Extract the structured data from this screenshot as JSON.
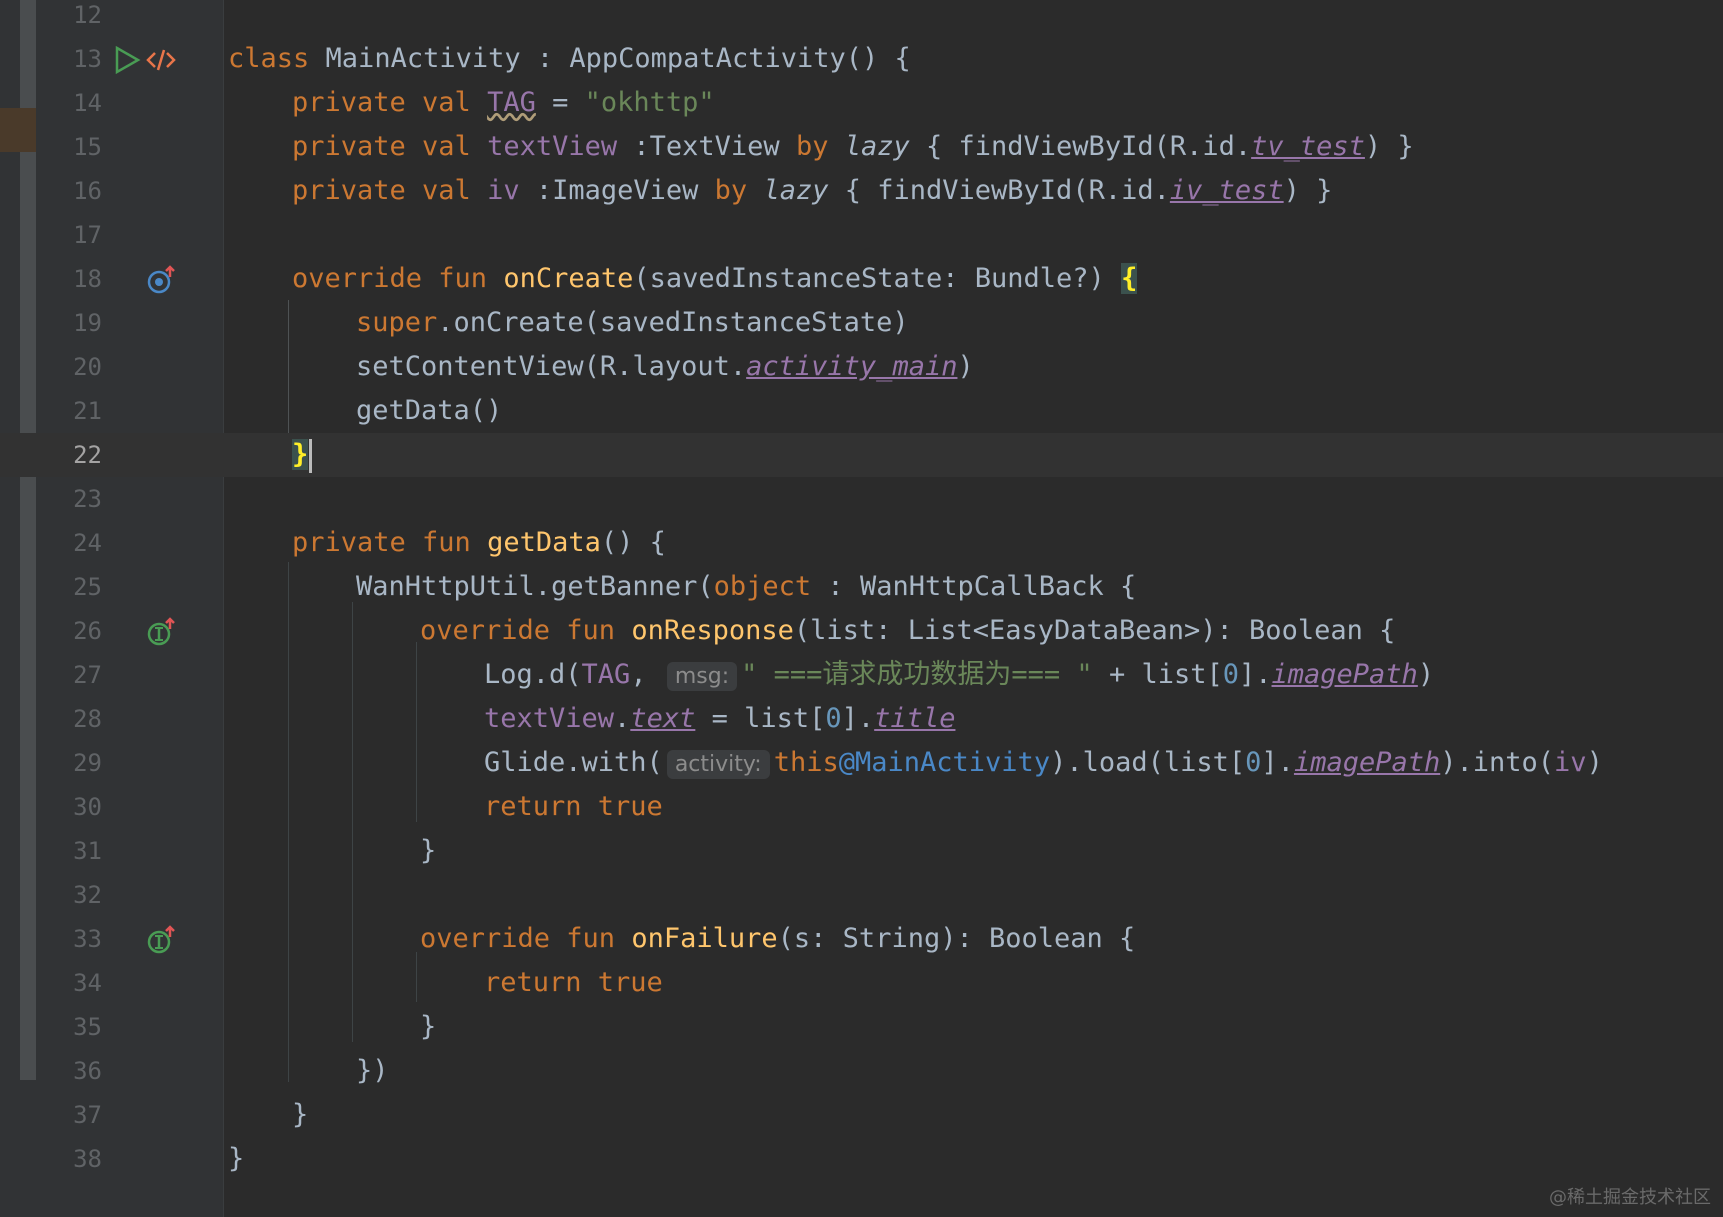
{
  "editor": {
    "language": "kotlin",
    "current_line": "22",
    "lines": [
      {
        "n": "12"
      },
      {
        "n": "13",
        "t1": "class",
        "t2": "MainActivity",
        "t3": " : AppCompatActivity() {"
      },
      {
        "n": "14",
        "t1": "private val",
        "t2": "TAG",
        "t3": " = ",
        "t4": "\"okhttp\""
      },
      {
        "n": "15",
        "t1": "private val",
        "t2": "textView",
        "t3": " :TextView ",
        "t4": "by",
        "t5": "lazy",
        "t6": " { findViewById(R.id.",
        "t7": "tv_test",
        "t8": ") }"
      },
      {
        "n": "16",
        "t1": "private val",
        "t2": "iv",
        "t3": " :ImageView ",
        "t4": "by",
        "t5": "lazy",
        "t6": " { findViewById(R.id.",
        "t7": "iv_test",
        "t8": ") }"
      },
      {
        "n": "17"
      },
      {
        "n": "18",
        "t1": "override fun",
        "t2": "onCreate",
        "t3": "(savedInstanceState: Bundle?) ",
        "t4": "{"
      },
      {
        "n": "19",
        "t1": "super",
        "t2": ".onCreate(savedInstanceState)"
      },
      {
        "n": "20",
        "t1": "setContentView(R.layout.",
        "t2": "activity_main",
        "t3": ")"
      },
      {
        "n": "21",
        "t1": "getData()"
      },
      {
        "n": "22",
        "t1": "}"
      },
      {
        "n": "23"
      },
      {
        "n": "24",
        "t1": "private fun",
        "t2": "getData",
        "t3": "() {"
      },
      {
        "n": "25",
        "t1": "WanHttpUtil.getBanner(",
        "t2": "object",
        "t3": " : WanHttpCallBack {"
      },
      {
        "n": "26",
        "t1": "override fun",
        "t2": "onResponse",
        "t3": "(list: List<EasyDataBean>): Boolean {"
      },
      {
        "n": "27",
        "t1": "Log.d(",
        "t2": "TAG",
        "t3": ", ",
        "hint": "msg:",
        "t4": "\" ===请求成功数据为=== \"",
        "t5": " + list[",
        "t6": "0",
        "t7": "].",
        "t8": "imagePath",
        "t9": ")"
      },
      {
        "n": "28",
        "t1": "textView",
        "t2": ".",
        "t3": "text",
        "t4": " = list[",
        "t5": "0",
        "t6": "].",
        "t7": "title"
      },
      {
        "n": "29",
        "t1": "Glide.with(",
        "hint": "activity:",
        "t2": "this",
        "t3": "@MainActivity",
        "t4": ").load(list[",
        "t5": "0",
        "t6": "].",
        "t7": "imagePath",
        "t8": ").into(",
        "t9": "iv",
        "t10": ")"
      },
      {
        "n": "30",
        "t1": "return true"
      },
      {
        "n": "31",
        "t1": "}"
      },
      {
        "n": "32"
      },
      {
        "n": "33",
        "t1": "override fun",
        "t2": "onFailure",
        "t3": "(s: String): Boolean {"
      },
      {
        "n": "34",
        "t1": "return true"
      },
      {
        "n": "35",
        "t1": "}"
      },
      {
        "n": "36",
        "t1": "})"
      },
      {
        "n": "37",
        "t1": "}"
      },
      {
        "n": "38",
        "t1": "}"
      }
    ]
  },
  "gutter_icons": {
    "line13": [
      "run-icon",
      "code-tag-icon"
    ],
    "line18": "override-icon",
    "line26": "implements-icon",
    "line33": "implements-icon"
  },
  "colors": {
    "background": "#2b2b2b",
    "keyword": "#cc7832",
    "function": "#ffc66d",
    "string": "#6a8759",
    "number": "#6897bb",
    "property": "#9876aa",
    "text": "#a9b7c6",
    "line_number": "#606366"
  },
  "watermark": "@稀土掘金技术社区"
}
